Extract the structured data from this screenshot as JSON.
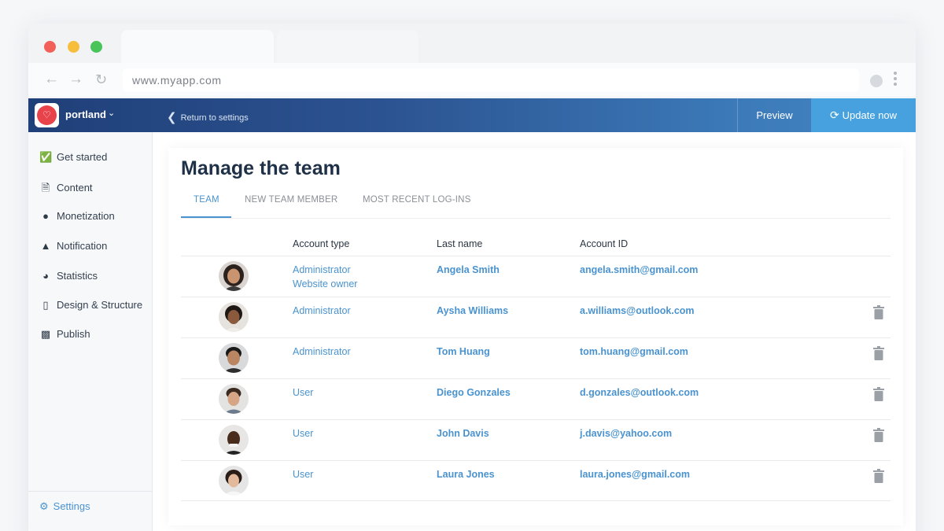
{
  "browser": {
    "url": "www.myapp.com"
  },
  "header": {
    "brand_name": "portland",
    "back_label": "Return to settings",
    "preview_label": "Preview",
    "update_label": "Update now"
  },
  "sidebar": {
    "items": [
      {
        "label": "Get started",
        "icon": "check-circle-icon"
      },
      {
        "label": "Content",
        "icon": "document-icon"
      },
      {
        "label": "Monetization",
        "icon": "dollar-icon"
      },
      {
        "label": "Notification",
        "icon": "bell-icon"
      },
      {
        "label": "Statistics",
        "icon": "pie-chart-icon"
      },
      {
        "label": "Design & Structure",
        "icon": "mobile-icon"
      },
      {
        "label": "Publish",
        "icon": "store-icon"
      }
    ],
    "settings_label": "Settings"
  },
  "main": {
    "title": "Manage the team",
    "tabs": [
      {
        "label": "TEAM",
        "active": true
      },
      {
        "label": "NEW TEAM MEMBER",
        "active": false
      },
      {
        "label": "MOST RECENT LOG-INS",
        "active": false
      }
    ],
    "columns": [
      "Account type",
      "Last name",
      "Account ID"
    ],
    "rows": [
      {
        "type": "Administrator",
        "type2": "Website owner",
        "name": "Angela Smith",
        "email": "angela.smith@gmail.com",
        "deletable": false
      },
      {
        "type": "Administrator",
        "type2": "",
        "name": "Aysha Williams",
        "email": "a.williams@outlook.com",
        "deletable": true
      },
      {
        "type": "Administrator",
        "type2": "",
        "name": "Tom Huang",
        "email": "tom.huang@gmail.com",
        "deletable": true
      },
      {
        "type": "User",
        "type2": "",
        "name": "Diego Gonzales",
        "email": "d.gonzales@outlook.com",
        "deletable": true
      },
      {
        "type": "User",
        "type2": "",
        "name": "John Davis",
        "email": "j.davis@yahoo.com",
        "deletable": true
      },
      {
        "type": "User",
        "type2": "",
        "name": "Laura Jones",
        "email": "laura.jones@gmail.com",
        "deletable": true
      }
    ]
  },
  "colors": {
    "header_start": "#1f3f78",
    "header_end": "#4586c2",
    "accent": "#4a93cf",
    "update_button": "#46a1de"
  }
}
